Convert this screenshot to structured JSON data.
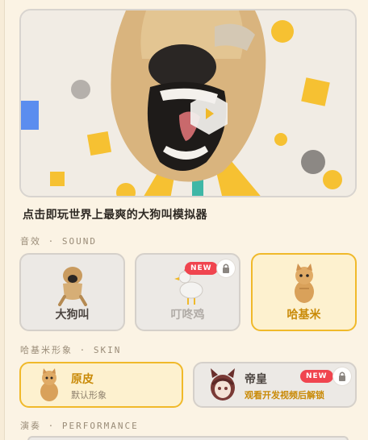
{
  "hero": {
    "title": "点击即玩世界上最爽的大狗叫模拟器",
    "play_icon": "play-icon"
  },
  "sections": {
    "sound": "音效 · SOUND",
    "skin": "哈基米形象 · SKIN",
    "performance": "演奏 · PERFORMANCE"
  },
  "sounds": [
    {
      "label": "大狗叫",
      "state": "default"
    },
    {
      "label": "叮咚鸡",
      "state": "locked",
      "badge": "NEW"
    },
    {
      "label": "哈基米",
      "state": "selected"
    }
  ],
  "skins": [
    {
      "name": "原皮",
      "desc": "默认形象",
      "state": "selected"
    },
    {
      "name": "帝皇",
      "desc": "观看开发视频后解锁",
      "state": "locked",
      "badge": "NEW"
    }
  ],
  "colors": {
    "accent": "#f0b92a",
    "badge": "#f0454f",
    "background": "#fbf3e4"
  }
}
